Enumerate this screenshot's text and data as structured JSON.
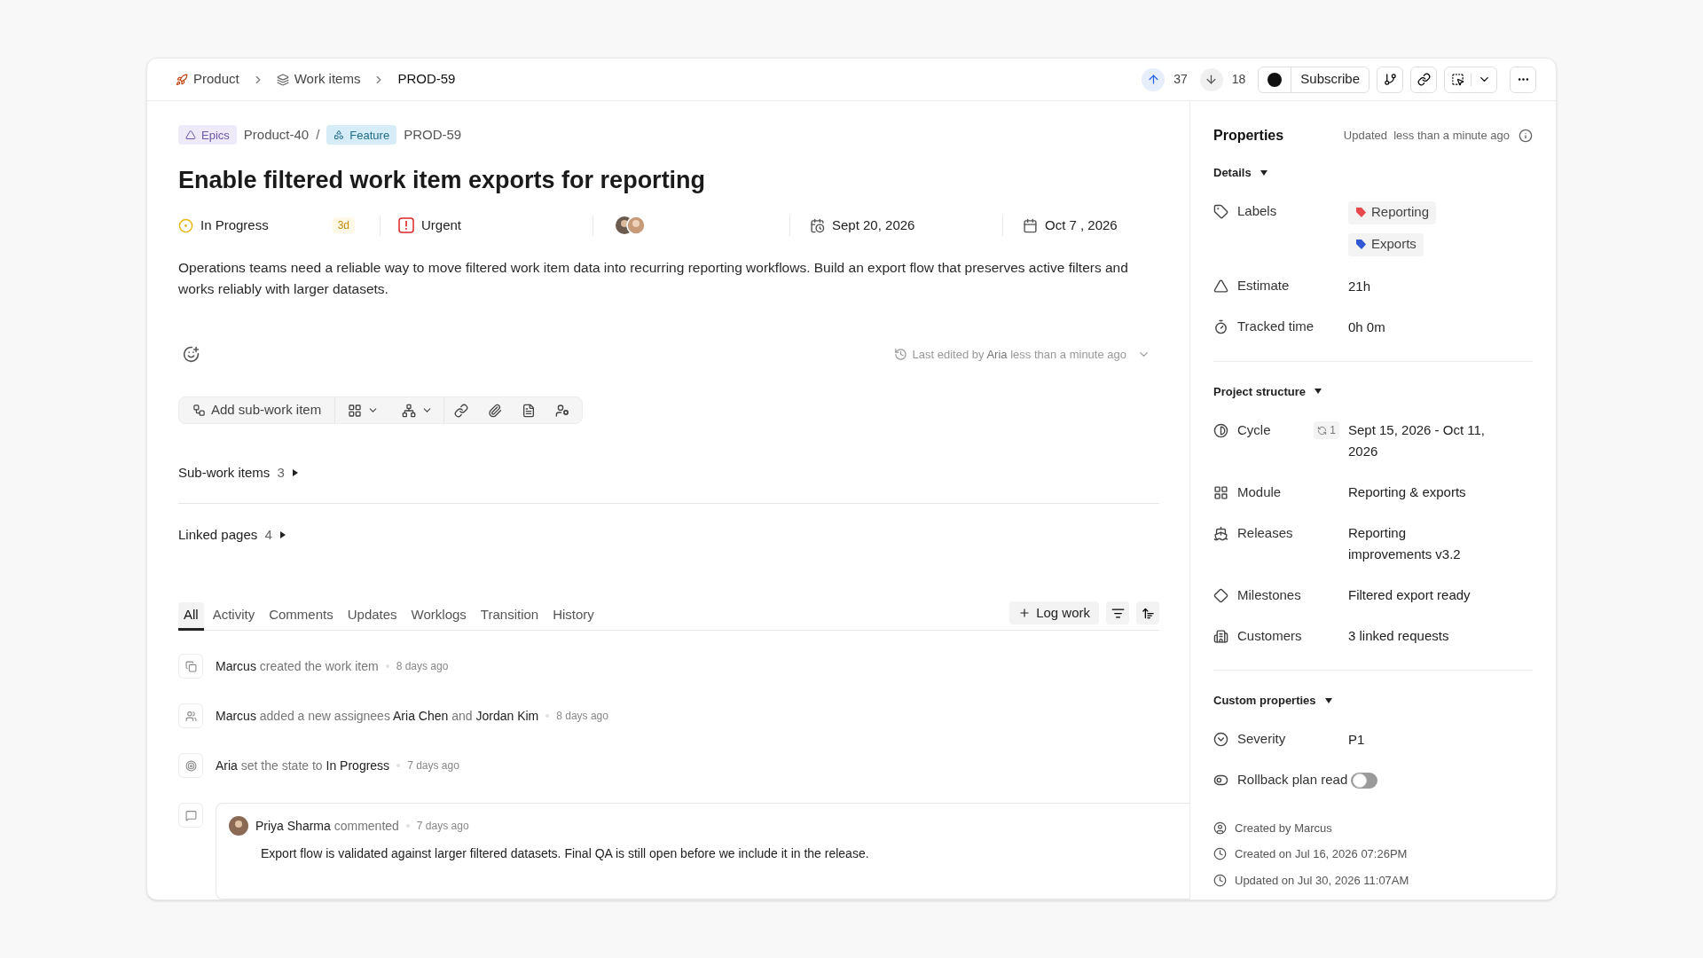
{
  "breadcrumb": [
    {
      "label": "Product",
      "kind": "project"
    },
    {
      "label": "Work items",
      "kind": "items"
    },
    {
      "label": "PROD-59",
      "kind": "current"
    }
  ],
  "votes": {
    "up": "37",
    "down": "18"
  },
  "header_actions": {
    "subscribe": "Subscribe"
  },
  "parents": [
    {
      "kind": "epic",
      "badge": "Epics",
      "id": "Product-40"
    },
    {
      "kind": "feature",
      "badge": "Feature",
      "id": "PROD-59"
    }
  ],
  "parent_separator": "/",
  "title": "Enable filtered work item exports for reporting",
  "meta": {
    "state": "In Progress",
    "state_age": "3d",
    "priority": "Urgent",
    "start_date": "Sept 20, 2026",
    "due_date": "Oct 7 , 2026"
  },
  "description": "Operations teams need a reliable way to move filtered work item data into recurring reporting workflows. Build an export flow that preserves active filters and works reliably with larger datasets.",
  "last_edited": {
    "prefix": "Last edited by",
    "user": "Aria",
    "time": "less than a minute ago"
  },
  "toolbar": {
    "add_sub_item": "Add sub-work item"
  },
  "sections": [
    {
      "label": "Sub-work items",
      "count": "3",
      "expanded": false
    },
    {
      "label": "Linked pages",
      "count": "4",
      "expanded": false
    }
  ],
  "tabs": [
    {
      "label": "All",
      "selected": true
    },
    {
      "label": "Activity",
      "selected": false
    },
    {
      "label": "Comments",
      "selected": false
    },
    {
      "label": "Updates",
      "selected": false
    },
    {
      "label": "Worklogs",
      "selected": false
    },
    {
      "label": "Transition",
      "selected": false
    },
    {
      "label": "History",
      "selected": false
    }
  ],
  "log_work": "Log work",
  "activity": [
    {
      "kind": "created",
      "text": "**Marcus** created the work item",
      "time": "8 days ago"
    },
    {
      "kind": "assignees",
      "text": "**Marcus** added a new assignees **Aria Chen** and **Jordan Kim**",
      "time": "8 days ago"
    },
    {
      "kind": "state",
      "text": "**Aria** set the state to **In Progress**",
      "time": "7 days ago"
    }
  ],
  "comment": {
    "author": "Priya Sharma",
    "action": "commented",
    "time": "7 days ago",
    "body": "Export flow is validated against larger filtered datasets. Final QA is still open before we include it in the release."
  },
  "properties": {
    "title": "Properties",
    "updated_label": "Updated",
    "updated_time": "less than a minute ago",
    "groups": [
      {
        "label": "Details",
        "expanded": true,
        "rows": [
          {
            "kind": "labels",
            "label": "Labels",
            "labels": [
              {
                "name": "Reporting",
                "color": "#e5484d"
              },
              {
                "name": "Exports",
                "color": "#3358d4"
              }
            ]
          },
          {
            "kind": "text",
            "label": "Estimate",
            "value": "21h"
          },
          {
            "kind": "text",
            "label": "Tracked time",
            "value": "0h 0m"
          }
        ]
      },
      {
        "label": "Project structure",
        "expanded": true,
        "rows": [
          {
            "kind": "cycle",
            "label": "Cycle",
            "count": "1",
            "value": "Sept 15, 2026 - Oct 11, 2026"
          },
          {
            "kind": "text",
            "label": "Module",
            "value": "Reporting & exports"
          },
          {
            "kind": "text",
            "label": "Releases",
            "value": "Reporting improvements v3.2"
          },
          {
            "kind": "text",
            "label": "Milestones",
            "value": "Filtered export ready"
          },
          {
            "kind": "text",
            "label": "Customers",
            "value": "3 linked requests"
          }
        ]
      },
      {
        "label": "Custom properties",
        "expanded": true,
        "rows": [
          {
            "kind": "text",
            "label": "Severity",
            "value": "P1"
          },
          {
            "kind": "toggle",
            "label": "Rollback plan read",
            "on": false
          }
        ]
      }
    ],
    "footer": [
      {
        "kind": "user",
        "text": "Created by Marcus"
      },
      {
        "kind": "created",
        "text": "Created on Jul 16, 2026 07:26PM"
      },
      {
        "kind": "updated",
        "text": "Updated on Jul 30, 2026 11:07AM"
      }
    ]
  }
}
